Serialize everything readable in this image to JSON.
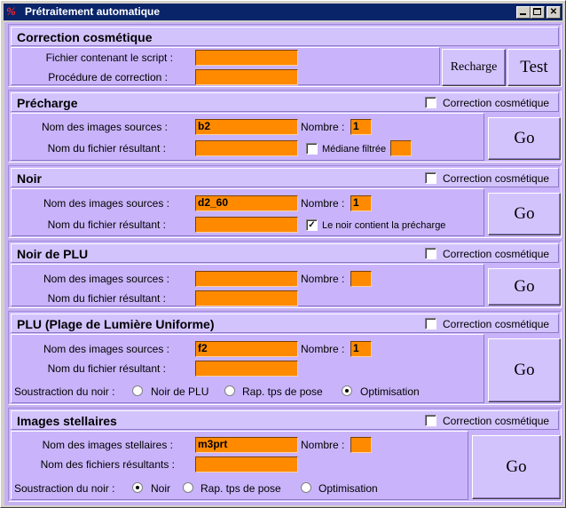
{
  "window": {
    "title": "Prétraitement automatique",
    "icon": "app-logo-icon"
  },
  "cosmetic": {
    "title": "Correction cosmétique",
    "script_label": "Fichier contenant le script :",
    "script_value": "",
    "procedure_label": "Procédure de correction :",
    "procedure_value": "",
    "recharge_label": "Recharge",
    "test_label": "Test"
  },
  "precharge": {
    "title": "Précharge",
    "cosmetic_label": "Correction cosmétique",
    "cosmetic_checked": false,
    "sources_label": "Nom des images sources :",
    "sources_value": "b2",
    "nombre_label": "Nombre :",
    "nombre_value": "1",
    "result_label": "Nom du fichier résultant :",
    "result_value": "",
    "median_label": "Médiane filtrée",
    "median_checked": false,
    "median_value": "",
    "go_label": "Go"
  },
  "noir": {
    "title": "Noir",
    "cosmetic_label": "Correction cosmétique",
    "cosmetic_checked": false,
    "sources_label": "Nom des images sources :",
    "sources_value": "d2_60",
    "nombre_label": "Nombre :",
    "nombre_value": "1",
    "result_label": "Nom du fichier résultant :",
    "result_value": "",
    "contains_label": "Le noir contient la précharge",
    "contains_checked": true,
    "go_label": "Go"
  },
  "noir_plu": {
    "title": "Noir de PLU",
    "cosmetic_label": "Correction cosmétique",
    "cosmetic_checked": false,
    "sources_label": "Nom des images sources :",
    "sources_value": "",
    "nombre_label": "Nombre :",
    "nombre_value": "",
    "result_label": "Nom du fichier résultant :",
    "result_value": "",
    "go_label": "Go"
  },
  "plu": {
    "title": "PLU (Plage de Lumière Uniforme)",
    "cosmetic_label": "Correction cosmétique",
    "cosmetic_checked": false,
    "sources_label": "Nom des images sources :",
    "sources_value": "f2",
    "nombre_label": "Nombre :",
    "nombre_value": "1",
    "result_label": "Nom du fichier résultant :",
    "result_value": "",
    "subtract_label": "Soustraction du noir :",
    "options": [
      "Noir de PLU",
      "Rap. tps de pose",
      "Optimisation"
    ],
    "selected": "Optimisation",
    "go_label": "Go"
  },
  "stellar": {
    "title": "Images stellaires",
    "cosmetic_label": "Correction cosmétique",
    "cosmetic_checked": false,
    "sources_label": "Nom des images stellaires :",
    "sources_value": "m3prt",
    "nombre_label": "Nombre :",
    "nombre_value": "",
    "result_label": "Nom des fichiers résultants :",
    "result_value": "",
    "subtract_label": "Soustraction du noir :",
    "options": [
      "Noir",
      "Rap. tps de pose",
      "Optimisation"
    ],
    "selected": "Noir",
    "go_label": "Go"
  }
}
